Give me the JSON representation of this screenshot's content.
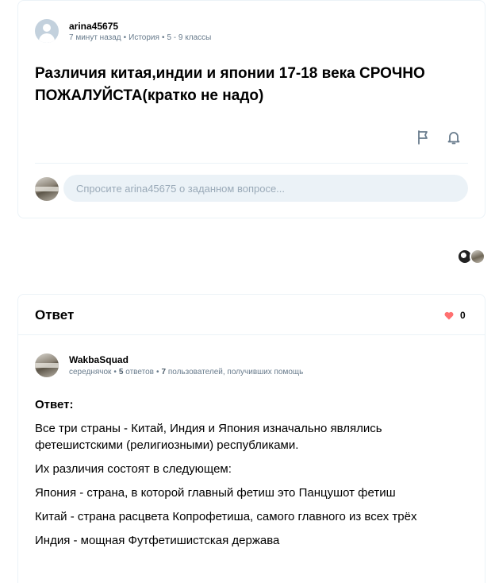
{
  "question": {
    "author": "arina45675",
    "time": "7 минут назад",
    "subject": "История",
    "grade": "5 - 9 классы",
    "title": "Различия китая,индии и японии 17-18 века СРОЧНО ПОЖАЛУЙСТА(кратко не надо)",
    "comment_placeholder": "Спросите arina45675 о заданном вопросе...",
    "icons": [
      "flag-icon",
      "bell-icon"
    ]
  },
  "answer": {
    "header": "Ответ",
    "likes": "0",
    "author": "WakbaSquad",
    "rank": "середнячок",
    "answers_count": "5",
    "answers_label": "ответов",
    "helped_count": "7",
    "helped_label": "пользователей, получивших помощь",
    "label": "Ответ:",
    "paragraphs": [
      "Все три страны - Китай, Индия и Япония изначально являлись фетешистскими (религиозными) республиками.",
      "Их различия состоят в следующем:",
      "Япония - страна, в которой главный фетиш это Панцушот фетиш",
      "Китай - страна расцвета Копрофетиша, самого главного из всех трёх",
      "Индия - мощная Футфетишистская держава"
    ]
  },
  "colors": {
    "heart": "#ff7070",
    "muted_text": "#687b8c",
    "input_bg": "#ebf2f7"
  }
}
